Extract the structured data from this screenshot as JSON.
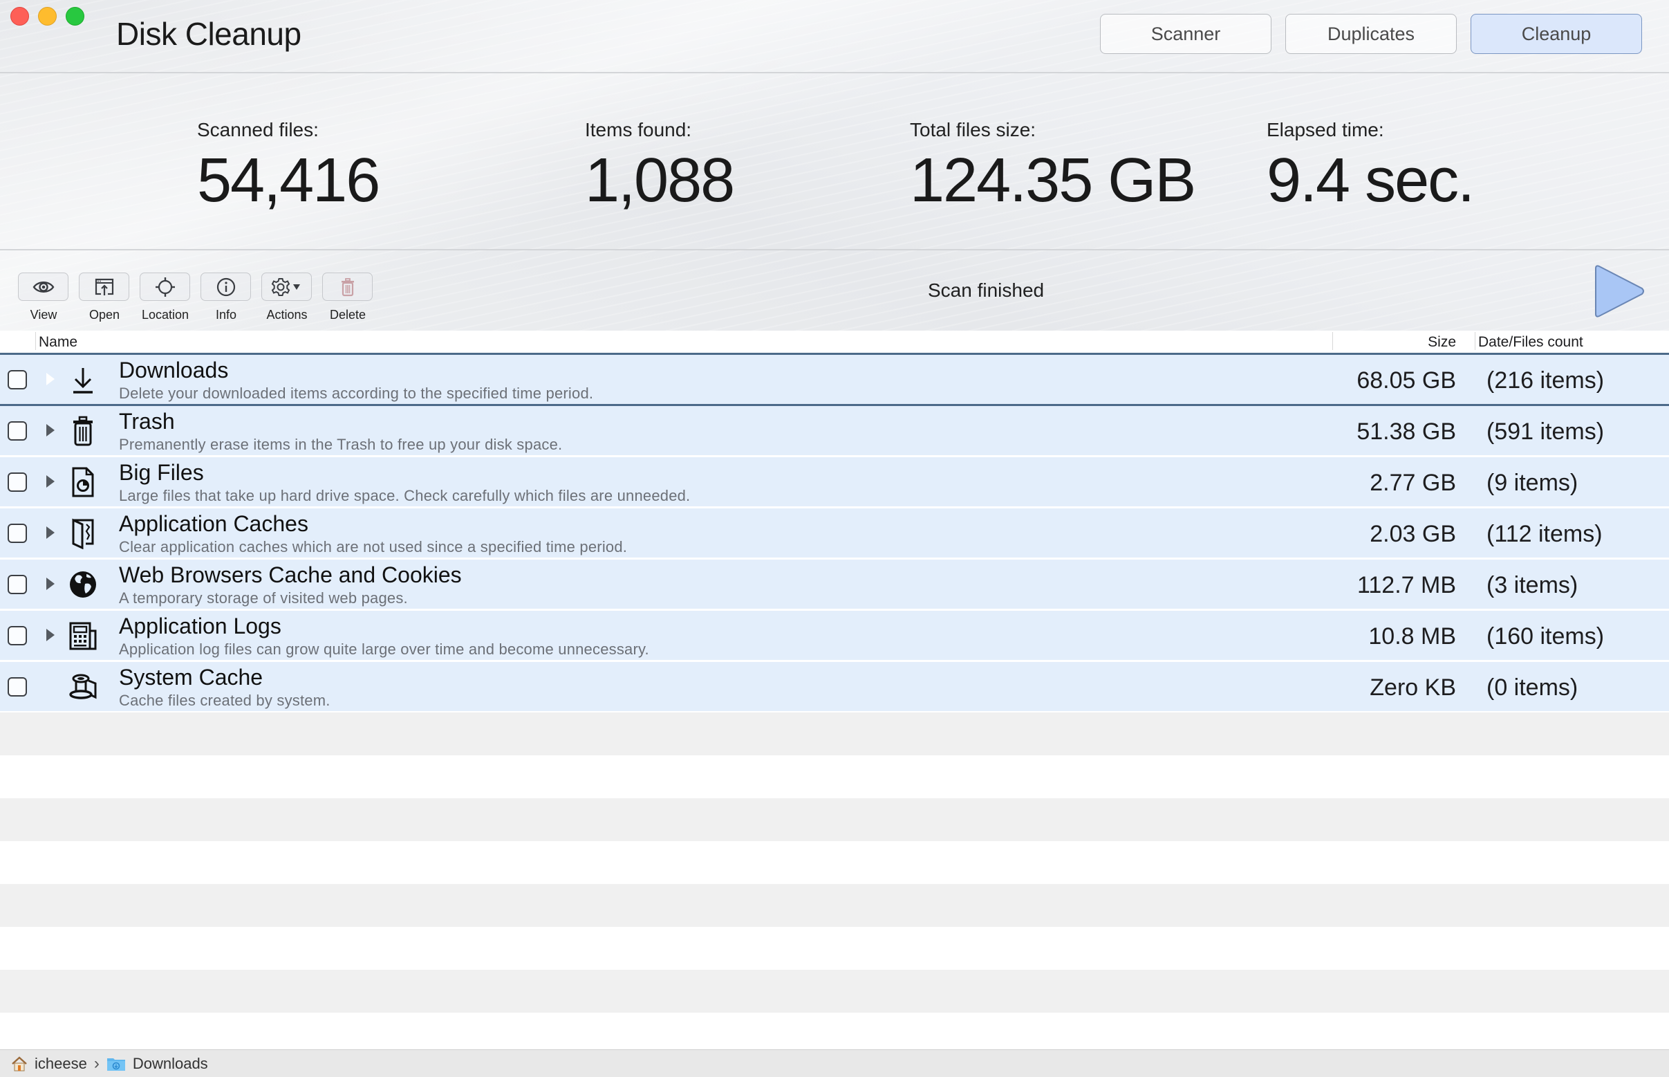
{
  "window": {
    "title": "Disk Cleanup",
    "traffic_lights": [
      "close",
      "minimize",
      "zoom"
    ]
  },
  "mode_tabs": [
    {
      "label": "Scanner",
      "active": false
    },
    {
      "label": "Duplicates",
      "active": false
    },
    {
      "label": "Cleanup",
      "active": true
    }
  ],
  "stats": {
    "scanned_files": {
      "label": "Scanned files:",
      "value": "54,416"
    },
    "items_found": {
      "label": "Items found:",
      "value": "1,088"
    },
    "total_size": {
      "label": "Total files size:",
      "value": "124.35 GB"
    },
    "elapsed": {
      "label": "Elapsed time:",
      "value": "9.4 sec."
    }
  },
  "toolbar": {
    "buttons": [
      {
        "label": "View",
        "icon": "eye-icon"
      },
      {
        "label": "Open",
        "icon": "open-window-icon"
      },
      {
        "label": "Location",
        "icon": "crosshair-icon"
      },
      {
        "label": "Info",
        "icon": "info-icon"
      },
      {
        "label": "Actions",
        "icon": "gear-dropdown-icon"
      },
      {
        "label": "Delete",
        "icon": "trash-icon"
      }
    ],
    "status": "Scan finished",
    "start_icon": "play-icon"
  },
  "table": {
    "columns": {
      "name": "Name",
      "size": "Size",
      "count": "Date/Files count"
    },
    "rows": [
      {
        "title": "Downloads",
        "description": "Delete your downloaded items according to the specified time period.",
        "size": "68.05 GB",
        "count": "(216 items)",
        "icon": "download-icon",
        "selected": true,
        "checked": false
      },
      {
        "title": "Trash",
        "description": "Premanently erase items in the Trash to free up your disk space.",
        "size": "51.38 GB",
        "count": "(591 items)",
        "icon": "trash-icon",
        "selected": false,
        "checked": false
      },
      {
        "title": "Big Files",
        "description": "Large files that take up hard drive space. Check carefully which files are unneeded.",
        "size": "2.77 GB",
        "count": "(9 items)",
        "icon": "big-file-icon",
        "selected": false,
        "checked": false
      },
      {
        "title": "Application Caches",
        "description": "Clear application caches which are not used since a specified time period.",
        "size": "2.03 GB",
        "count": "(112 items)",
        "icon": "app-cache-icon",
        "selected": false,
        "checked": false
      },
      {
        "title": "Web Browsers Cache and Cookies",
        "description": "A temporary storage of visited web pages.",
        "size": "112.7 MB",
        "count": "(3 items)",
        "icon": "globe-icon",
        "selected": false,
        "checked": false
      },
      {
        "title": "Application Logs",
        "description": "Application log files can grow quite large over time and become unnecessary.",
        "size": "10.8 MB",
        "count": "(160 items)",
        "icon": "log-icon",
        "selected": false,
        "checked": false
      },
      {
        "title": "System Cache",
        "description": "Cache files created by system.",
        "size": "Zero KB",
        "count": "(0 items)",
        "icon": "spool-icon",
        "selected": false,
        "checked": false
      }
    ]
  },
  "path_bar": {
    "items": [
      {
        "label": "icheese",
        "icon": "home-icon"
      },
      {
        "label": "Downloads",
        "icon": "downloads-folder-icon"
      }
    ]
  },
  "colors": {
    "accent_selected_border": "#4c6a89",
    "row_background": "#e3eefb",
    "active_tab": "#dbe7fb",
    "play_button": "#a9c6f5"
  }
}
